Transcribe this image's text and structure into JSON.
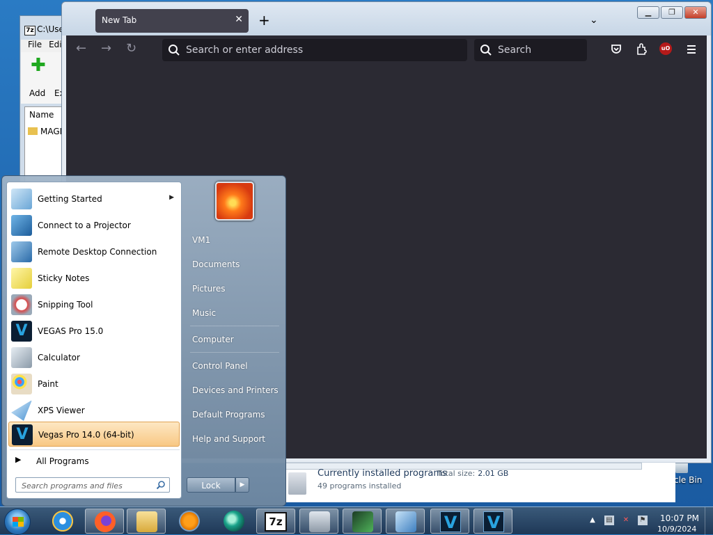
{
  "desktop": {
    "recycle_bin_label": "cle Bin"
  },
  "zip_window": {
    "title": "C:\\Use",
    "logo": "7z",
    "menu": [
      "File",
      "Edi"
    ],
    "add_label": "Add",
    "extract_label": "Ex",
    "column_name": "Name",
    "row_folder": "MAGI"
  },
  "firefox": {
    "tab_title": "New Tab",
    "urlbar_placeholder": "Search or enter address",
    "searchbar_placeholder": "Search",
    "ublock_label": "uO",
    "content_bg": "#2b2a33"
  },
  "control_panel": {
    "title": "Currently installed programs",
    "total_label": "Total size:",
    "total_value": "2.01 GB",
    "count": "49 programs installed"
  },
  "start_menu": {
    "programs": [
      {
        "label": "Getting Started",
        "icon": "getting-started-icon",
        "submenu": true
      },
      {
        "label": "Connect to a Projector",
        "icon": "projector-icon"
      },
      {
        "label": "Remote Desktop Connection",
        "icon": "remote-desktop-icon"
      },
      {
        "label": "Sticky Notes",
        "icon": "sticky-notes-icon"
      },
      {
        "label": "Snipping Tool",
        "icon": "snipping-tool-icon"
      },
      {
        "label": "VEGAS Pro 15.0",
        "icon": "vegas-icon"
      },
      {
        "label": "Calculator",
        "icon": "calculator-icon"
      },
      {
        "label": "Paint",
        "icon": "paint-icon"
      },
      {
        "label": "XPS Viewer",
        "icon": "xps-viewer-icon"
      },
      {
        "label": "Vegas Pro 14.0 (64-bit)",
        "icon": "vegas-icon",
        "highlighted": true
      }
    ],
    "all_programs": "All Programs",
    "search_placeholder": "Search programs and files",
    "right_items": [
      "VM1",
      "Documents",
      "Pictures",
      "Music",
      "Computer",
      "Control Panel",
      "Devices and Printers",
      "Default Programs",
      "Help and Support"
    ],
    "lock_label": "Lock"
  },
  "taskbar": {
    "items": [
      "firefox",
      "internet-explorer",
      "file-explorer",
      "media-player",
      "vm-app",
      "7zip",
      "control-panel",
      "task-manager",
      "remote-desktop",
      "vegas-15",
      "vegas-14"
    ],
    "clock_time": "10:07 PM",
    "clock_date": "10/9/2024"
  }
}
